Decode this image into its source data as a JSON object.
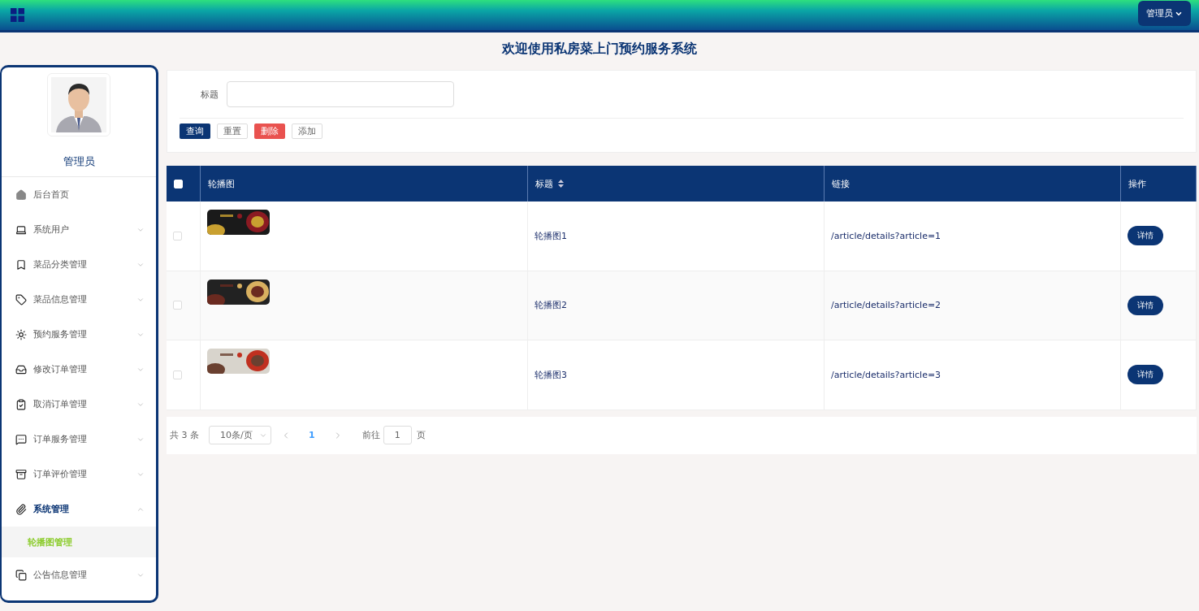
{
  "header": {
    "user_menu": "管理员"
  },
  "page_title": "欢迎使用私房菜上门预约服务系统",
  "sidebar": {
    "user_name": "管理员",
    "items": [
      {
        "label": "后台首页",
        "has_children": false,
        "expanded": false
      },
      {
        "label": "系统用户",
        "has_children": true,
        "expanded": false
      },
      {
        "label": "菜品分类管理",
        "has_children": true,
        "expanded": false
      },
      {
        "label": "菜品信息管理",
        "has_children": true,
        "expanded": false
      },
      {
        "label": "预约服务管理",
        "has_children": true,
        "expanded": false
      },
      {
        "label": "修改订单管理",
        "has_children": true,
        "expanded": false
      },
      {
        "label": "取消订单管理",
        "has_children": true,
        "expanded": false
      },
      {
        "label": "订单服务管理",
        "has_children": true,
        "expanded": false
      },
      {
        "label": "订单评价管理",
        "has_children": true,
        "expanded": false
      },
      {
        "label": "系统管理",
        "has_children": true,
        "expanded": true,
        "children": [
          {
            "label": "轮播图管理",
            "selected": true
          }
        ]
      },
      {
        "label": "公告信息管理",
        "has_children": true,
        "expanded": false
      }
    ]
  },
  "search": {
    "label": "标题"
  },
  "actions": [
    {
      "label": "查询",
      "kind": "primary"
    },
    {
      "label": "重置",
      "kind": "plain"
    },
    {
      "label": "删除",
      "kind": "danger"
    },
    {
      "label": "添加",
      "kind": "plain"
    }
  ],
  "table": {
    "all_checked": false,
    "columns": [
      "轮播图",
      "标题",
      "链接",
      "操作"
    ],
    "rows": [
      {
        "checked": false,
        "title": "轮播图1",
        "link": "/article/details?article=1",
        "action": "详情"
      },
      {
        "checked": false,
        "title": "轮播图2",
        "link": "/article/details?article=2",
        "action": "详情"
      },
      {
        "checked": false,
        "title": "轮播图3",
        "link": "/article/details?article=3",
        "action": "详情"
      }
    ]
  },
  "pagination": {
    "total": "共 3 条",
    "page_size": "10条/页",
    "pages": [
      {
        "label": "1",
        "selected": true
      }
    ],
    "goto_label": "前往",
    "goto_value": "1",
    "goto_suffix": "页"
  }
}
